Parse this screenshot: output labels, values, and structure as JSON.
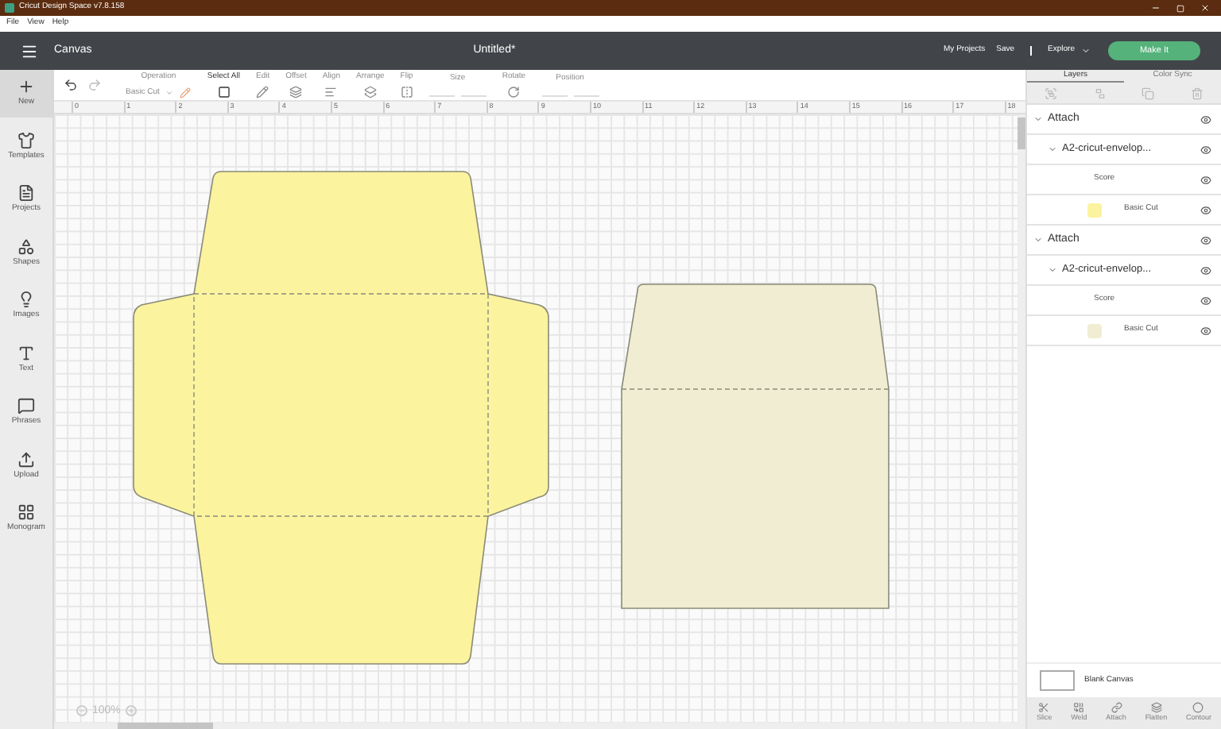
{
  "window": {
    "title": "Cricut Design Space  v7.8.158"
  },
  "menu": [
    "File",
    "View",
    "Help"
  ],
  "header": {
    "section": "Canvas",
    "document_title": "Untitled*",
    "links": [
      "My Projects",
      "Save"
    ],
    "explore": "Explore",
    "make_button": "Make It"
  },
  "sidebar": {
    "items": [
      {
        "label": "New",
        "selected": true
      },
      {
        "label": "Templates",
        "selected": false
      },
      {
        "label": "Projects",
        "selected": false
      },
      {
        "label": "Shapes",
        "selected": false
      },
      {
        "label": "Images",
        "selected": false
      },
      {
        "label": "Text",
        "selected": false
      },
      {
        "label": "Phrases",
        "selected": false
      },
      {
        "label": "Upload",
        "selected": false
      },
      {
        "label": "Monogram",
        "selected": false
      }
    ]
  },
  "toolbar": {
    "items": [
      {
        "label": "Operation",
        "kind": "dropdown",
        "value": "Basic Cut",
        "disabled": true
      },
      {
        "label": "Select All",
        "kind": "icon",
        "disabled": false
      },
      {
        "label": "Edit",
        "kind": "icon",
        "disabled": true
      },
      {
        "label": "Offset",
        "kind": "icon",
        "disabled": true
      },
      {
        "label": "Align",
        "kind": "icon",
        "disabled": true
      },
      {
        "label": "Arrange",
        "kind": "icon",
        "disabled": true
      },
      {
        "label": "Flip",
        "kind": "icon",
        "disabled": true
      },
      {
        "label": "Size",
        "kind": "size",
        "disabled": true
      },
      {
        "label": "Rotate",
        "kind": "icon",
        "disabled": true
      },
      {
        "label": "Position",
        "kind": "size",
        "disabled": true
      }
    ]
  },
  "ruler": [
    "0",
    "1",
    "2",
    "3",
    "4",
    "5",
    "6",
    "7",
    "8",
    "9",
    "10",
    "11",
    "12",
    "13",
    "14",
    "15",
    "16",
    "17",
    "18"
  ],
  "zoom": {
    "value": "100%"
  },
  "layers_panel": {
    "tabs": [
      {
        "label": "Layers",
        "selected": true
      },
      {
        "label": "Color Sync",
        "selected": false
      }
    ],
    "groups": [
      {
        "label": "Attach",
        "expanded": true,
        "children": [
          {
            "label": "A2-cricut-envelop...",
            "expanded": true,
            "children": [
              {
                "label": "Score",
                "kind": "score"
              },
              {
                "label": "Basic Cut",
                "kind": "cut",
                "color": "#fbf39e"
              }
            ]
          }
        ]
      },
      {
        "label": "Attach",
        "expanded": true,
        "children": [
          {
            "label": "A2-cricut-envelop...",
            "expanded": true,
            "children": [
              {
                "label": "Score",
                "kind": "score"
              },
              {
                "label": "Basic Cut",
                "kind": "cut",
                "color": "#f0edd2"
              }
            ]
          }
        ]
      }
    ],
    "canvas_layer": "Blank Canvas",
    "actions": [
      "Slice",
      "Weld",
      "Attach",
      "Flatten",
      "Contour"
    ]
  }
}
